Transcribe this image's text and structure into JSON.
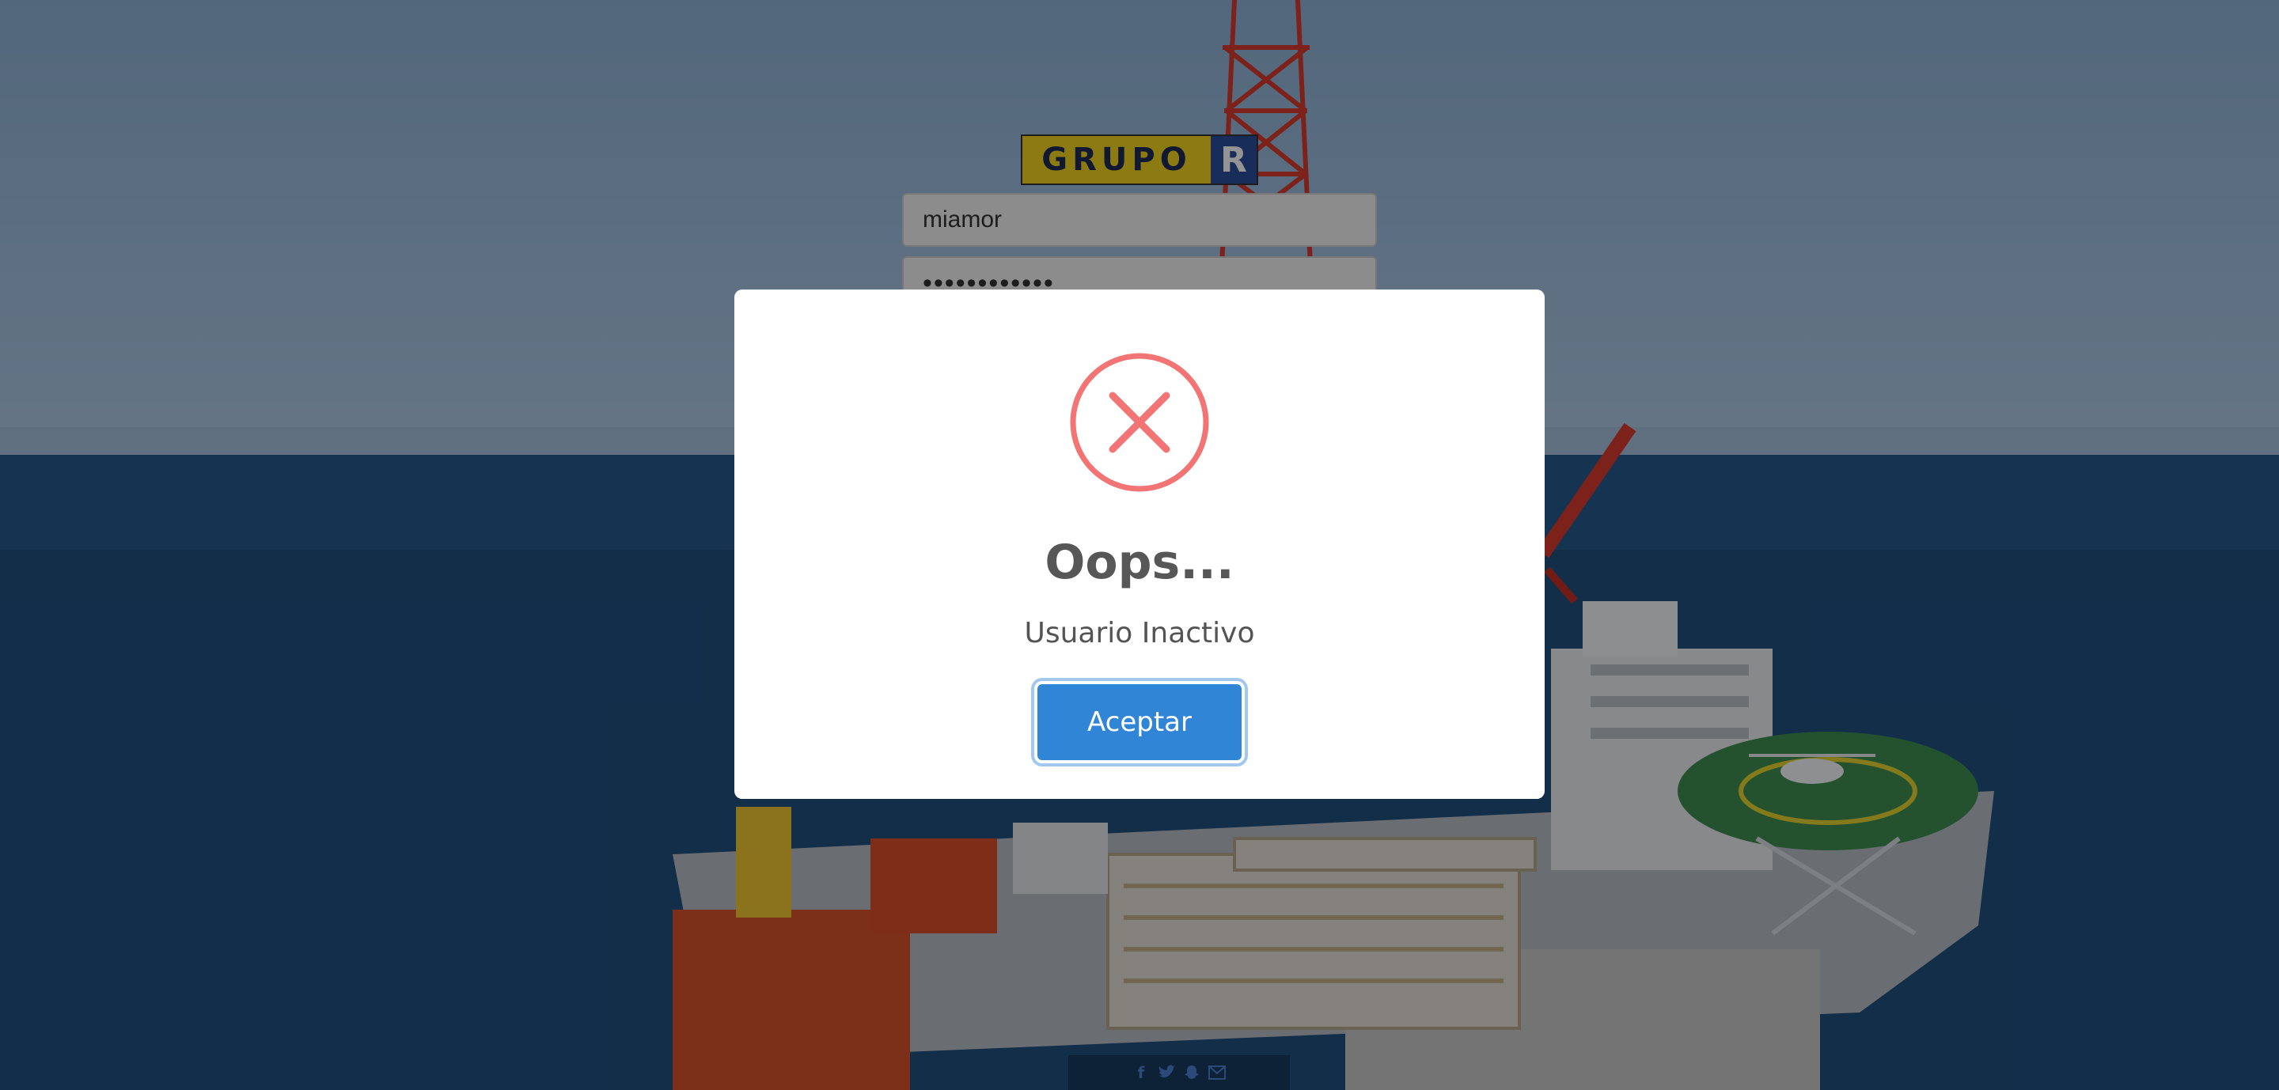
{
  "login": {
    "logo_left": "GRUPO",
    "logo_right": "R",
    "username_value": "miamor",
    "password_mask": "••••••••••••"
  },
  "footer": {
    "icons": [
      "facebook-icon",
      "twitter-icon",
      "snapchat-icon",
      "mail-icon"
    ]
  },
  "dialog": {
    "title": "Oops...",
    "message": "Usuario Inactivo",
    "confirm_label": "Aceptar",
    "icon": "error-x-icon",
    "icon_color": "#f27474",
    "button_color": "#3085d6"
  }
}
